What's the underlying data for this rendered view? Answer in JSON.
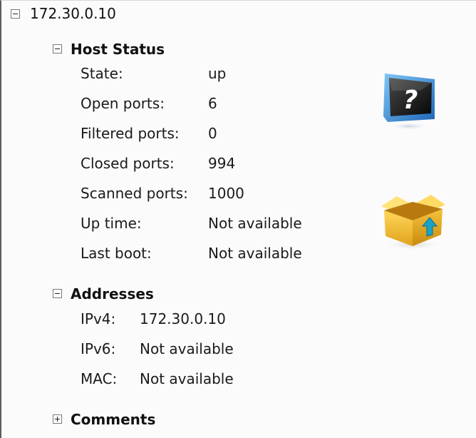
{
  "host": {
    "ip": "172.30.0.10"
  },
  "host_status": {
    "title": "Host Status",
    "rows": [
      {
        "label": "State:",
        "value": "up"
      },
      {
        "label": "Open ports:",
        "value": "6"
      },
      {
        "label": "Filtered ports:",
        "value": "0"
      },
      {
        "label": "Closed ports:",
        "value": "994"
      },
      {
        "label": "Scanned ports:",
        "value": "1000"
      },
      {
        "label": "Up time:",
        "value": "Not available"
      },
      {
        "label": "Last boot:",
        "value": "Not available"
      }
    ],
    "icons": [
      "unknown-os-monitor-icon",
      "open-box-icon"
    ]
  },
  "addresses": {
    "title": "Addresses",
    "rows": [
      {
        "label": "IPv4:",
        "value": "172.30.0.10"
      },
      {
        "label": "IPv6:",
        "value": "Not available"
      },
      {
        "label": "MAC:",
        "value": "Not available"
      }
    ]
  },
  "comments": {
    "title": "Comments"
  }
}
